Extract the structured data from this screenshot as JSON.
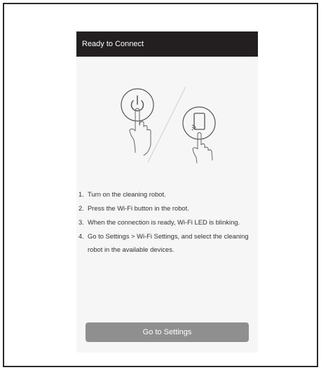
{
  "header": {
    "title": "Ready to Connect"
  },
  "illustration": {
    "left_icon": "power-icon",
    "right_icon": "phone-wifi-icon"
  },
  "steps": [
    {
      "num": "1.",
      "text": "Turn on the cleaning robot."
    },
    {
      "num": "2.",
      "text": "Press the Wi-Fi button in the robot."
    },
    {
      "num": "3.",
      "text": "When the connection is ready, Wi-Fi LED is blinking."
    },
    {
      "num": "4.",
      "text": "Go to Settings > Wi-Fi Settings, and select the cleaning robot in the available devices."
    }
  ],
  "footer": {
    "button_label": "Go to Settings"
  },
  "colors": {
    "header_bg": "#231f20",
    "screen_bg": "#f6f6f6",
    "button_bg": "#8f8f8f"
  }
}
